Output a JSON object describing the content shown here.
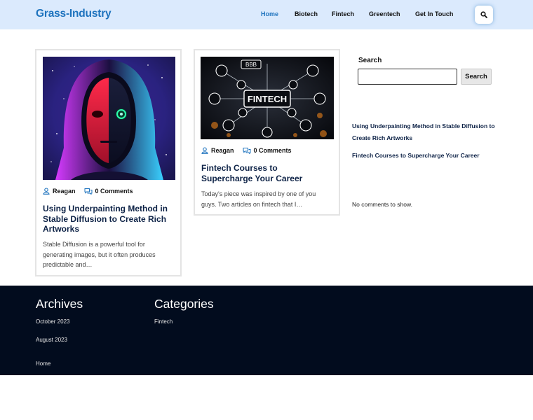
{
  "header": {
    "logo": "Grass-Industry",
    "nav": [
      {
        "label": "Home",
        "active": true
      },
      {
        "label": "Biotech"
      },
      {
        "label": "Fintech"
      },
      {
        "label": "Greentech"
      },
      {
        "label": "Get In Touch"
      }
    ],
    "search_icon": "search-icon",
    "accent": "#1e73be",
    "bg": "#dbeafd"
  },
  "posts": [
    {
      "image_alt": "Stable Diffusion artwork of a hooded android face",
      "author": "Reagan",
      "comments": "0 Comments",
      "title": "Using Underpainting Method in Stable Diffusion to Create Rich Artworks",
      "excerpt": "Stable Diffusion is a powerful tool for generating images, but it often produces predictable and…"
    },
    {
      "image_alt": "Fintech icon collage",
      "image_label": "FINTECH",
      "image_badge": "BBB",
      "author": "Reagan",
      "comments": "0 Comments",
      "title": "Fintech Courses to Supercharge Your Career",
      "excerpt": "Today's piece was inspired by one of you guys. Two articles on fintech that I…"
    }
  ],
  "sidebar": {
    "search_label": "Search",
    "search_placeholder": "",
    "search_button": "Search",
    "recent_posts": [
      "Using Underpainting Method in Stable Diffusion to Create Rich Artworks",
      "Fintech Courses to Supercharge Your Career"
    ],
    "no_comments": "No comments to show."
  },
  "footer": {
    "archives_title": "Archives",
    "archives": [
      "October 2023",
      "August 2023"
    ],
    "categories_title": "Categories",
    "categories": [
      "Fintech"
    ],
    "home_link": "Home",
    "bg": "#020c1e"
  }
}
